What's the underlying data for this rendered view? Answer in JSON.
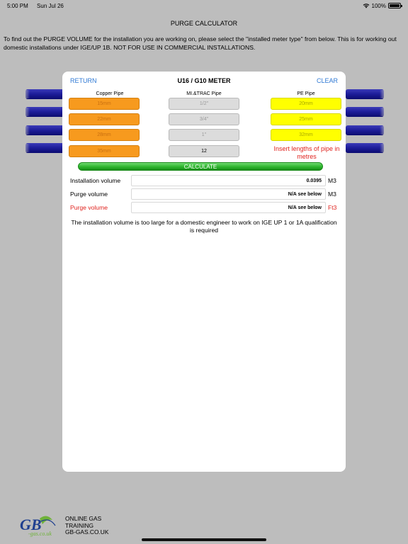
{
  "status_bar": {
    "time": "5:00 PM",
    "date": "Sun Jul 26",
    "battery": "100%"
  },
  "page_title": "PURGE CALCULATOR",
  "intro_text": "To find out the PURGE VOLUME for the installation you are working on, please select the \"installed meter type\" from below. This is for working out domestic installations under IGE/UP 1B. NOT FOR USE IN COMMERCIAL INSTALLATIONS.",
  "modal": {
    "return_label": "RETURN",
    "title": "U16 / G10  METER",
    "clear_label": "CLEAR",
    "columns": {
      "copper": "Copper Pipe",
      "mi": "MI.&TRAC Pipe",
      "pe": "PE Pipe"
    },
    "copper_inputs": [
      "15mm",
      "22mm",
      "28mm",
      "35mm"
    ],
    "mi_inputs": [
      "1/2\"",
      "3/4\"",
      "1\"",
      "12"
    ],
    "pe_inputs": [
      "20mm",
      "25mm",
      "32mm"
    ],
    "hint": "Insert lengths of pipe in metres",
    "calculate_label": "CALCULATE",
    "results": [
      {
        "label": "Installation volume",
        "value": "0.0395",
        "unit": "M3"
      },
      {
        "label": "Purge volume",
        "value": "N/A see below",
        "unit": "M3"
      },
      {
        "label": "Purge volume",
        "value": "N/A see below",
        "unit": "Ft3"
      }
    ],
    "message": "The installation volume is too large for a domestic engineer to work on IGE UP 1 or 1A qualification is required"
  },
  "footer": {
    "line1": "ONLINE GAS",
    "line2": "TRAINING",
    "line3": "GB-GAS.CO.UK",
    "logo_text": "GB",
    "logo_sub": "-gas.co.uk"
  },
  "colors": {
    "accent_blue": "#2f79d4",
    "warning_red": "#e0231e",
    "copper": "#f79a1e",
    "pe": "#ffff00",
    "calculate_green": "#2db52d"
  }
}
